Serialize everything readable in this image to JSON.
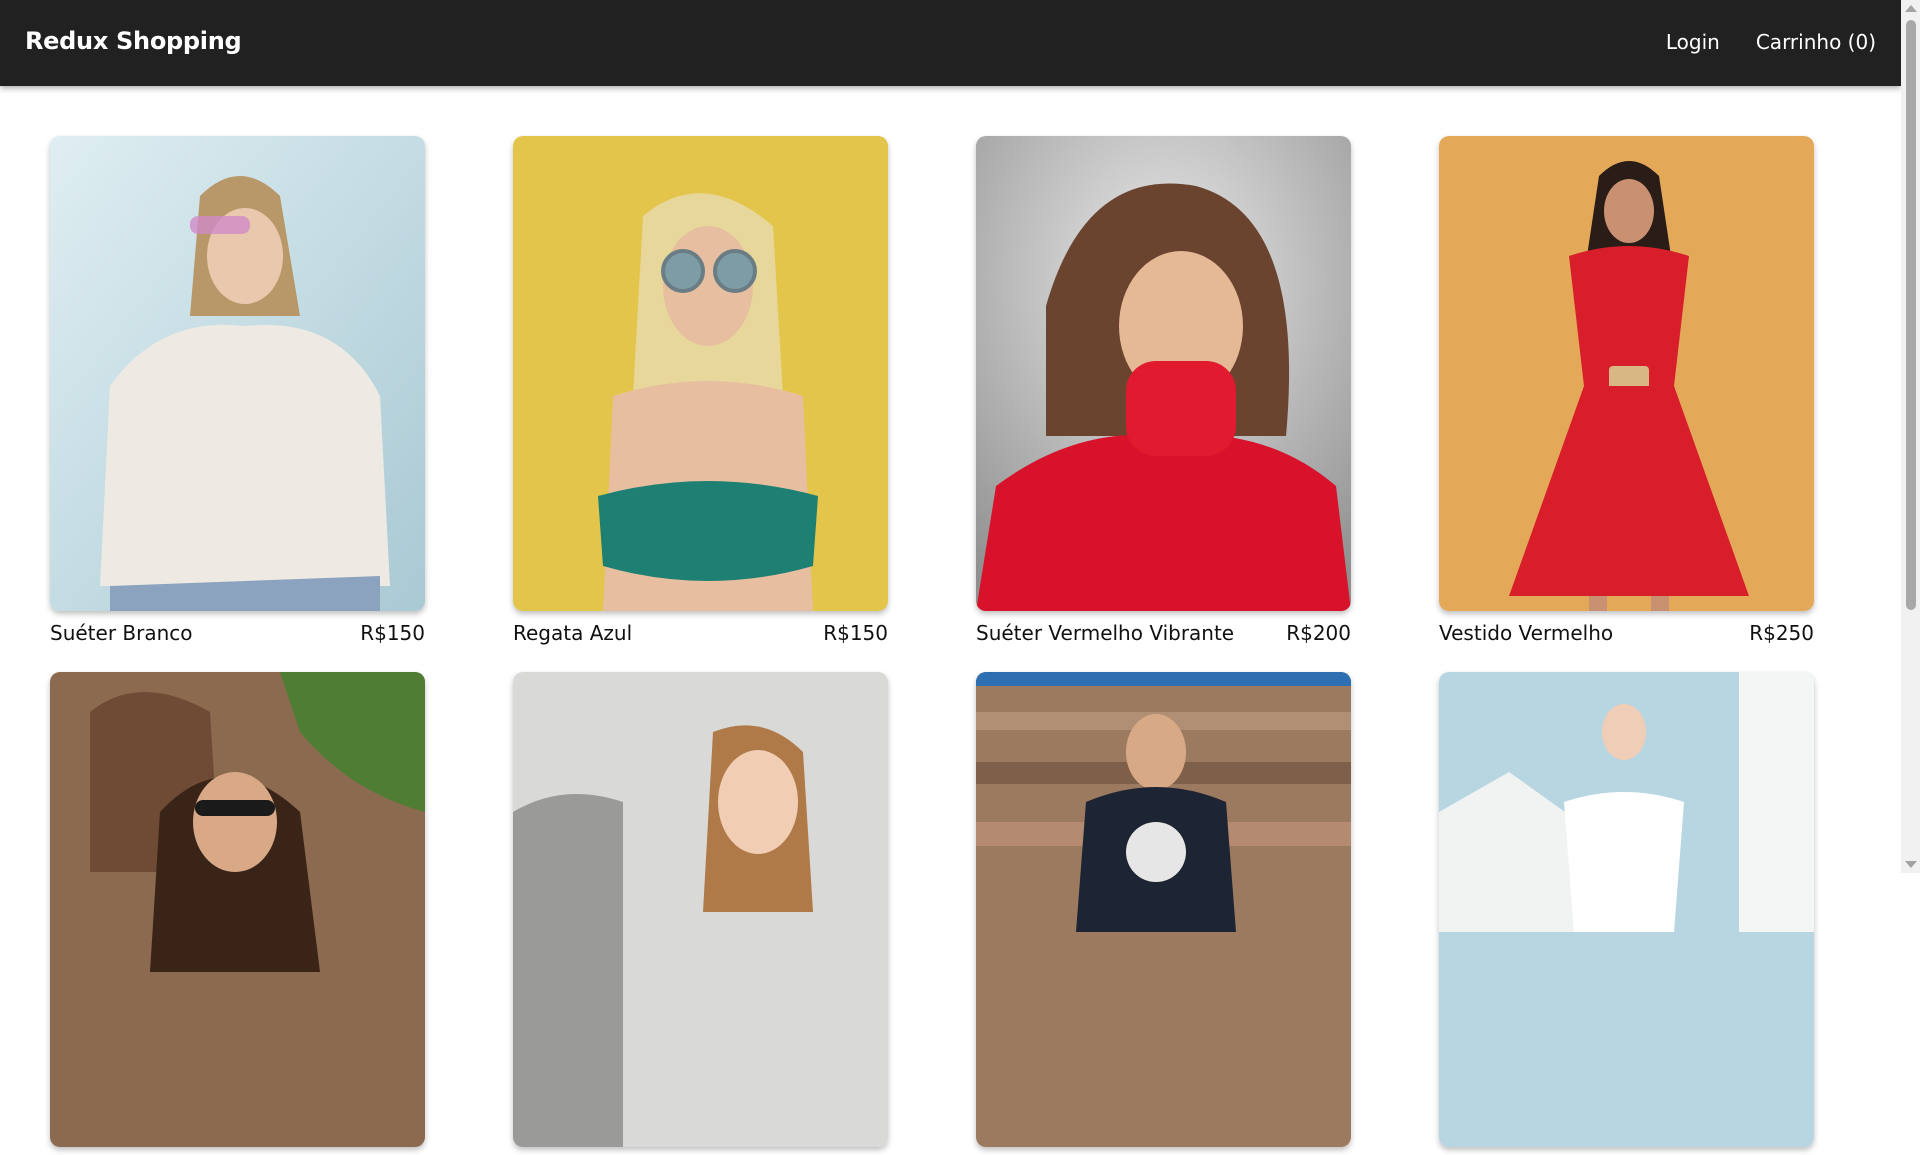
{
  "header": {
    "brand": "Redux Shopping",
    "nav": {
      "login": "Login",
      "cart": "Carrinho (0)"
    }
  },
  "products": [
    {
      "name": "Suéter Branco",
      "price": "R$150"
    },
    {
      "name": "Regata Azul",
      "price": "R$150"
    },
    {
      "name": "Suéter Vermelho Vibrante",
      "price": "R$200"
    },
    {
      "name": "Vestido Vermelho",
      "price": "R$250"
    },
    {
      "name": "",
      "price": ""
    },
    {
      "name": "",
      "price": ""
    },
    {
      "name": "",
      "price": ""
    },
    {
      "name": "",
      "price": ""
    }
  ],
  "colors": {
    "header_bg": "#212121",
    "header_text": "#ffffff"
  }
}
